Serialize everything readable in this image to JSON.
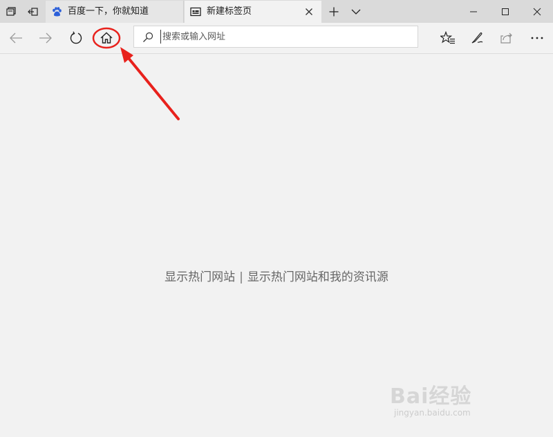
{
  "tabs": [
    {
      "title": "百度一下，你就知道",
      "favicon": "baidu-paw-icon",
      "active": false
    },
    {
      "title": "新建标签页",
      "favicon": "new-tab-page-icon",
      "active": true
    }
  ],
  "tabbar": {
    "icons": [
      "tab-list-icon",
      "set-tabs-aside-icon",
      "new-tab-plus-icon",
      "tab-preview-chevron-icon"
    ]
  },
  "window_controls": [
    "minimize-icon",
    "maximize-icon",
    "close-icon"
  ],
  "nav": {
    "buttons": [
      "back-arrow-icon",
      "forward-arrow-icon",
      "refresh-icon",
      "home-icon"
    ],
    "address_placeholder": "搜索或输入网址",
    "address_value": ""
  },
  "toolbar_right": [
    "favorites-star-icon",
    "web-note-pen-icon",
    "share-icon",
    "more-dots-icon"
  ],
  "content": {
    "hint_left": "显示热门网站",
    "separator": "|",
    "hint_right": "显示热门网站和我的资讯源"
  },
  "annotation": {
    "color": "#e8211c",
    "target": "home-icon"
  },
  "watermark": {
    "brand": "Bai经验",
    "url": "jingyan.baidu.com"
  }
}
